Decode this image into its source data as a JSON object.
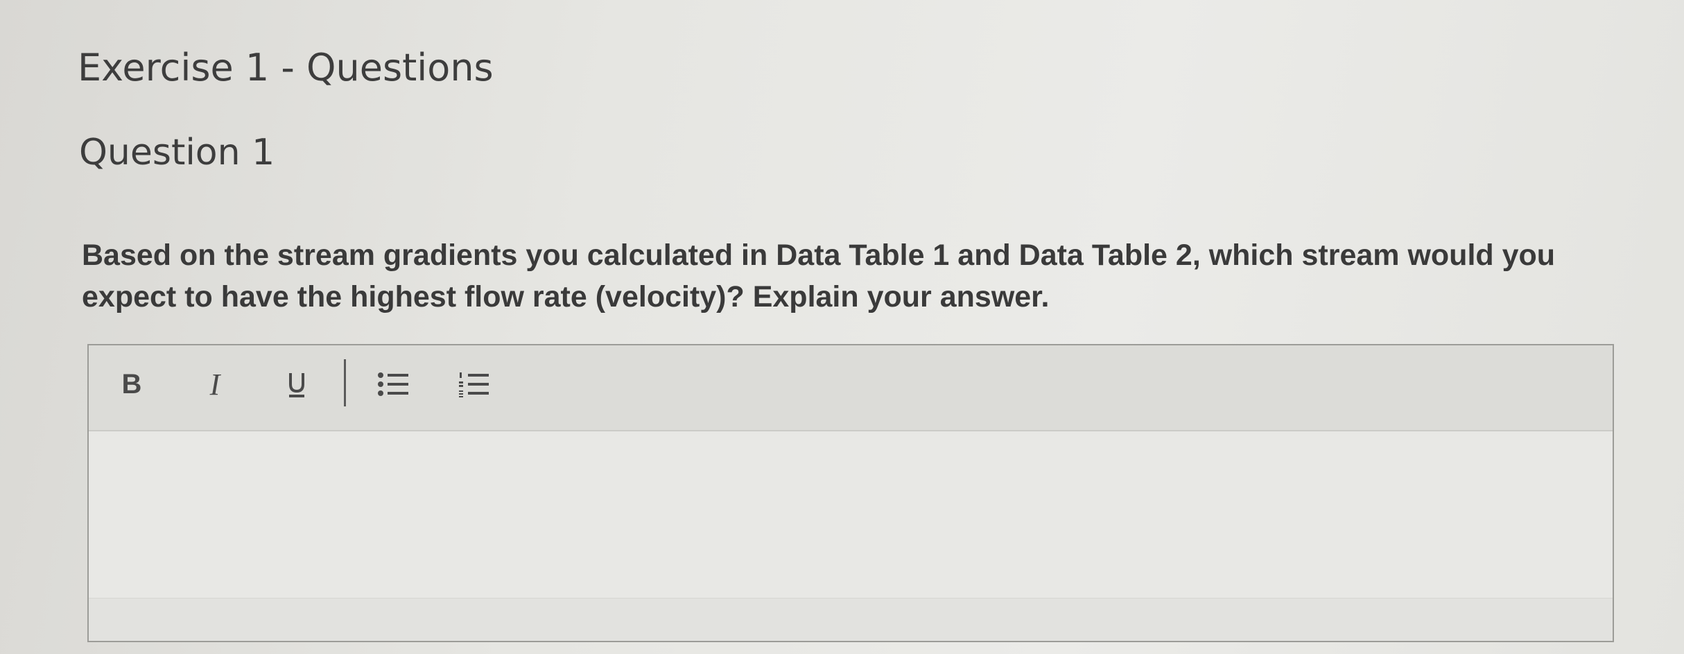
{
  "page": {
    "exercise_title": "Exercise 1 - Questions",
    "question_title": "Question 1",
    "question_text": "Based on the stream gradients you calculated in Data Table 1 and Data Table 2, which stream would you expect to have the highest flow rate (velocity)? Explain your answer."
  },
  "editor": {
    "toolbar": {
      "bold_label": "B",
      "italic_label": "I",
      "underline_icon": "underline-icon",
      "bullet_list_icon": "bulleted-list-icon",
      "numbered_list_icon": "numbered-list-icon"
    },
    "value": ""
  },
  "colors": {
    "background": "#e6e6e2",
    "text": "#3a3a3a",
    "toolbar_bg": "#dcdcd8",
    "editor_border": "#9c9c98"
  }
}
